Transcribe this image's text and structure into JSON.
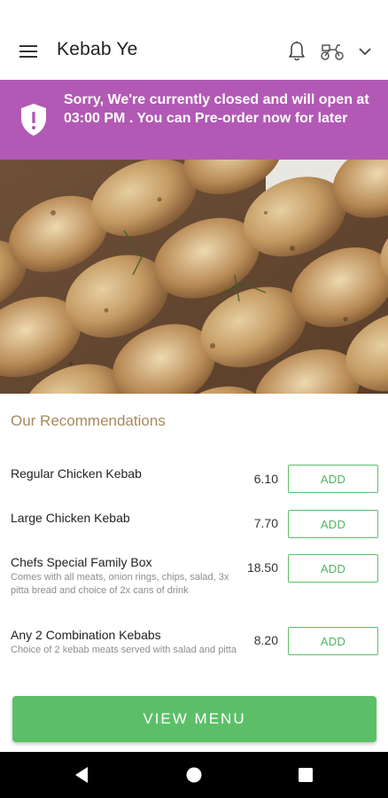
{
  "header": {
    "title": "Kebab Ye",
    "icons": [
      "hamburger-menu-icon",
      "bell-icon",
      "scooter-delivery-icon",
      "chevron-down-icon"
    ]
  },
  "banner": {
    "message": "Sorry, We're currently closed and will open at 03:00 PM . You can Pre-order now for later",
    "icon": "shield-alert-icon",
    "color": "#b259b5"
  },
  "hero": {
    "alt": "chicken-kebab-skewers-photo"
  },
  "recommendations": {
    "title": "Our Recommendations",
    "items": [
      {
        "name": "Regular Chicken Kebab",
        "description": "",
        "price": "6.10",
        "add_label": "ADD"
      },
      {
        "name": "Large Chicken Kebab",
        "description": "",
        "price": "7.70",
        "add_label": "ADD"
      },
      {
        "name": "Chefs Special Family Box",
        "description": "Comes with all meats, onion rings, chips, salad, 3x pitta bread and choice of 2x cans of drink",
        "price": "18.50",
        "add_label": "ADD"
      },
      {
        "name": "Any 2 Combination Kebabs",
        "description": "Choice of 2 kebab meats served with salad and pitta",
        "price": "8.20",
        "add_label": "ADD"
      }
    ]
  },
  "footer": {
    "view_menu_label": "VIEW MENU",
    "accent": "#5cbf68"
  },
  "navbar": {
    "icons": [
      "back-icon",
      "home-icon",
      "recent-apps-icon"
    ]
  }
}
